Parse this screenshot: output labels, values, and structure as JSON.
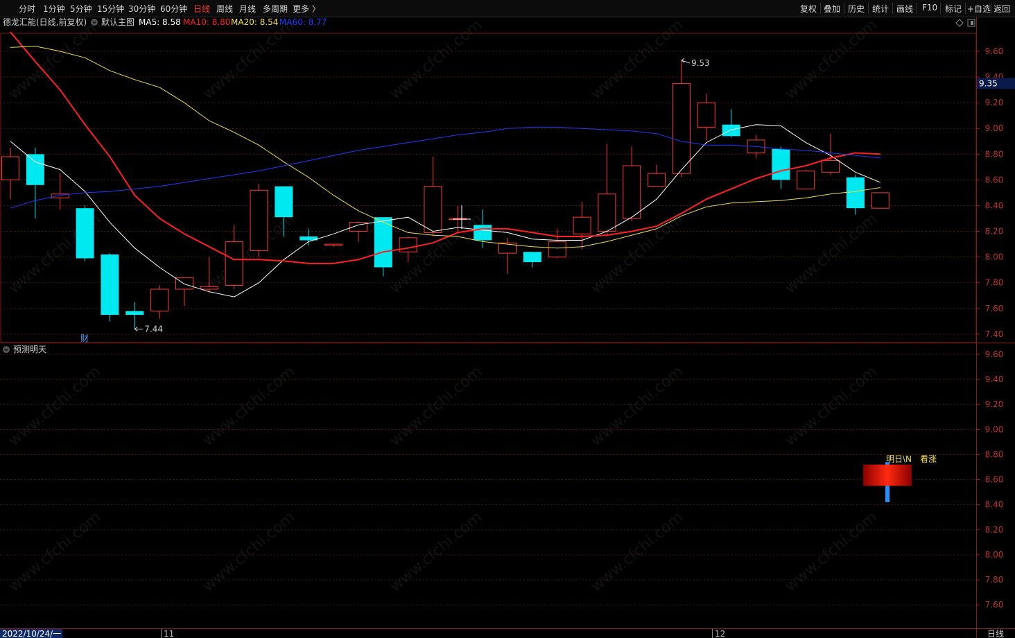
{
  "toolbar": {
    "periods": [
      "分时",
      "1分钟",
      "5分钟",
      "15分钟",
      "30分钟",
      "60分钟",
      "日线",
      "周线",
      "月线",
      "多周期",
      "更多 〉"
    ],
    "active_period": "日线",
    "right_items": [
      "复权",
      "叠加",
      "历史",
      "统计",
      "画线",
      "F10",
      "标记",
      "+自选",
      "返回"
    ]
  },
  "main_panel": {
    "stock_title": "德龙汇能(日线,前复权)",
    "template": "默认主图",
    "ma_legend": [
      {
        "label": "MA5: 8.58",
        "color": "#ffffff"
      },
      {
        "label": "MA10: 8.80",
        "color": "#ff2020"
      },
      {
        "label": "MA20: 8.54",
        "color": "#f0e040"
      },
      {
        "label": "MA60: 8.77",
        "color": "#1a3cff"
      }
    ],
    "high_label": "9.53",
    "low_label": "7.44",
    "price_tag": "9.35",
    "cai_badge": "财"
  },
  "sub_panel": {
    "title": "预测明天",
    "forecast_text_1": "明日\\N",
    "forecast_text_2": "看涨"
  },
  "bottom": {
    "date_label": "2022/10/24/一",
    "month_labels": [
      "11",
      "12"
    ],
    "period_label": "日线"
  },
  "chart_data": [
    {
      "type": "candlestick",
      "title": "德龙汇能(日线,前复权)",
      "ylim": [
        7.35,
        9.75
      ],
      "y_ticks": [
        "9.60",
        "9.40",
        "9.20",
        "9.00",
        "8.80",
        "8.60",
        "8.40",
        "8.20",
        "8.00",
        "7.80",
        "7.60",
        "7.40"
      ],
      "candles": [
        {
          "o": 8.6,
          "h": 8.85,
          "l": 8.45,
          "c": 8.78
        },
        {
          "o": 8.8,
          "h": 8.85,
          "l": 8.3,
          "c": 8.56
        },
        {
          "o": 8.46,
          "h": 8.65,
          "l": 8.37,
          "c": 8.49
        },
        {
          "o": 8.38,
          "h": 8.4,
          "l": 7.97,
          "c": 7.99
        },
        {
          "o": 8.02,
          "h": 8.03,
          "l": 7.5,
          "c": 7.55
        },
        {
          "o": 7.58,
          "h": 7.65,
          "l": 7.44,
          "c": 7.55
        },
        {
          "o": 7.58,
          "h": 7.78,
          "l": 7.52,
          "c": 7.75
        },
        {
          "o": 7.75,
          "h": 7.84,
          "l": 7.62,
          "c": 7.84
        },
        {
          "o": 7.75,
          "h": 8.0,
          "l": 7.72,
          "c": 7.77
        },
        {
          "o": 7.78,
          "h": 8.25,
          "l": 7.75,
          "c": 8.12
        },
        {
          "o": 8.05,
          "h": 8.57,
          "l": 8.0,
          "c": 8.52
        },
        {
          "o": 8.55,
          "h": 8.55,
          "l": 8.16,
          "c": 8.31
        },
        {
          "o": 8.16,
          "h": 8.22,
          "l": 8.09,
          "c": 8.13
        },
        {
          "o": 8.1,
          "h": 8.1,
          "l": 8.08,
          "c": 8.1
        },
        {
          "o": 8.2,
          "h": 8.28,
          "l": 8.12,
          "c": 8.27
        },
        {
          "o": 8.31,
          "h": 8.31,
          "l": 7.85,
          "c": 7.92
        },
        {
          "o": 8.04,
          "h": 8.16,
          "l": 7.96,
          "c": 8.15
        },
        {
          "o": 8.19,
          "h": 8.78,
          "l": 8.16,
          "c": 8.55
        },
        {
          "o": 8.3,
          "h": 8.4,
          "l": 8.2,
          "c": 8.3
        },
        {
          "o": 8.25,
          "h": 8.37,
          "l": 8.07,
          "c": 8.13
        },
        {
          "o": 8.03,
          "h": 8.15,
          "l": 7.87,
          "c": 8.11
        },
        {
          "o": 8.04,
          "h": 8.04,
          "l": 7.92,
          "c": 7.96
        },
        {
          "o": 8.0,
          "h": 8.22,
          "l": 7.99,
          "c": 8.12
        },
        {
          "o": 8.18,
          "h": 8.43,
          "l": 8.06,
          "c": 8.31
        },
        {
          "o": 8.2,
          "h": 8.88,
          "l": 8.16,
          "c": 8.49
        },
        {
          "o": 8.3,
          "h": 8.86,
          "l": 8.28,
          "c": 8.71
        },
        {
          "o": 8.55,
          "h": 8.72,
          "l": 8.55,
          "c": 8.65
        },
        {
          "o": 8.65,
          "h": 9.53,
          "l": 8.62,
          "c": 9.35
        },
        {
          "o": 9.01,
          "h": 9.27,
          "l": 8.91,
          "c": 9.2
        },
        {
          "o": 9.03,
          "h": 9.15,
          "l": 8.93,
          "c": 8.94
        },
        {
          "o": 8.81,
          "h": 8.95,
          "l": 8.77,
          "c": 8.91
        },
        {
          "o": 8.84,
          "h": 8.86,
          "l": 8.53,
          "c": 8.6
        },
        {
          "o": 8.53,
          "h": 8.68,
          "l": 8.53,
          "c": 8.67
        },
        {
          "o": 8.66,
          "h": 8.96,
          "l": 8.64,
          "c": 8.75
        },
        {
          "o": 8.62,
          "h": 8.64,
          "l": 8.33,
          "c": 8.38
        },
        {
          "o": 8.38,
          "h": 8.5,
          "l": 8.38,
          "c": 8.5
        }
      ],
      "series": [
        {
          "name": "MA5",
          "color": "#ffffff",
          "values": [
            8.9,
            8.74,
            8.68,
            8.51,
            8.27,
            8.07,
            7.92,
            7.79,
            7.73,
            7.69,
            7.8,
            7.98,
            8.12,
            8.18,
            8.25,
            8.28,
            8.31,
            8.2,
            8.23,
            8.21,
            8.19,
            8.14,
            8.13,
            8.13,
            8.2,
            8.31,
            8.45,
            8.68,
            8.89,
            8.99,
            9.03,
            9.02,
            8.89,
            8.79,
            8.66,
            8.58
          ]
        },
        {
          "name": "MA10",
          "color": "#ff2020",
          "values": [
            9.75,
            9.52,
            9.3,
            9.03,
            8.78,
            8.48,
            8.3,
            8.18,
            8.08,
            7.98,
            7.98,
            7.97,
            7.95,
            7.95,
            7.98,
            8.04,
            8.07,
            8.11,
            8.19,
            8.22,
            8.22,
            8.19,
            8.16,
            8.16,
            8.17,
            8.2,
            8.24,
            8.34,
            8.45,
            8.53,
            8.61,
            8.67,
            8.71,
            8.77,
            8.81,
            8.8
          ]
        },
        {
          "name": "MA20",
          "color": "#f0e040",
          "values": [
            9.63,
            9.64,
            9.6,
            9.55,
            9.45,
            9.38,
            9.32,
            9.2,
            9.06,
            8.97,
            8.87,
            8.74,
            8.62,
            8.48,
            8.36,
            8.27,
            8.19,
            8.17,
            8.16,
            8.12,
            8.1,
            8.08,
            8.07,
            8.08,
            8.12,
            8.17,
            8.22,
            8.32,
            8.39,
            8.42,
            8.43,
            8.44,
            8.46,
            8.49,
            8.51,
            8.54
          ]
        },
        {
          "name": "MA60",
          "color": "#1a3cff",
          "values": [
            8.38,
            8.44,
            8.48,
            8.5,
            8.51,
            8.53,
            8.55,
            8.58,
            8.61,
            8.64,
            8.67,
            8.71,
            8.75,
            8.79,
            8.83,
            8.86,
            8.89,
            8.92,
            8.95,
            8.97,
            9.0,
            9.01,
            9.01,
            9.0,
            8.99,
            8.98,
            8.96,
            8.9,
            8.87,
            8.87,
            8.86,
            8.84,
            8.83,
            8.81,
            8.79,
            8.77
          ]
        }
      ]
    },
    {
      "type": "bar",
      "title": "预测明天",
      "ylim": [
        7.55,
        9.75
      ],
      "y_ticks": [
        "9.60",
        "9.40",
        "9.20",
        "9.00",
        "8.80",
        "8.60",
        "8.40",
        "8.20",
        "8.00",
        "7.80",
        "7.60"
      ],
      "forecast_box": {
        "low": 8.55,
        "high": 8.72
      },
      "forecast_wick": {
        "low": 8.42,
        "high": 8.74
      }
    }
  ]
}
